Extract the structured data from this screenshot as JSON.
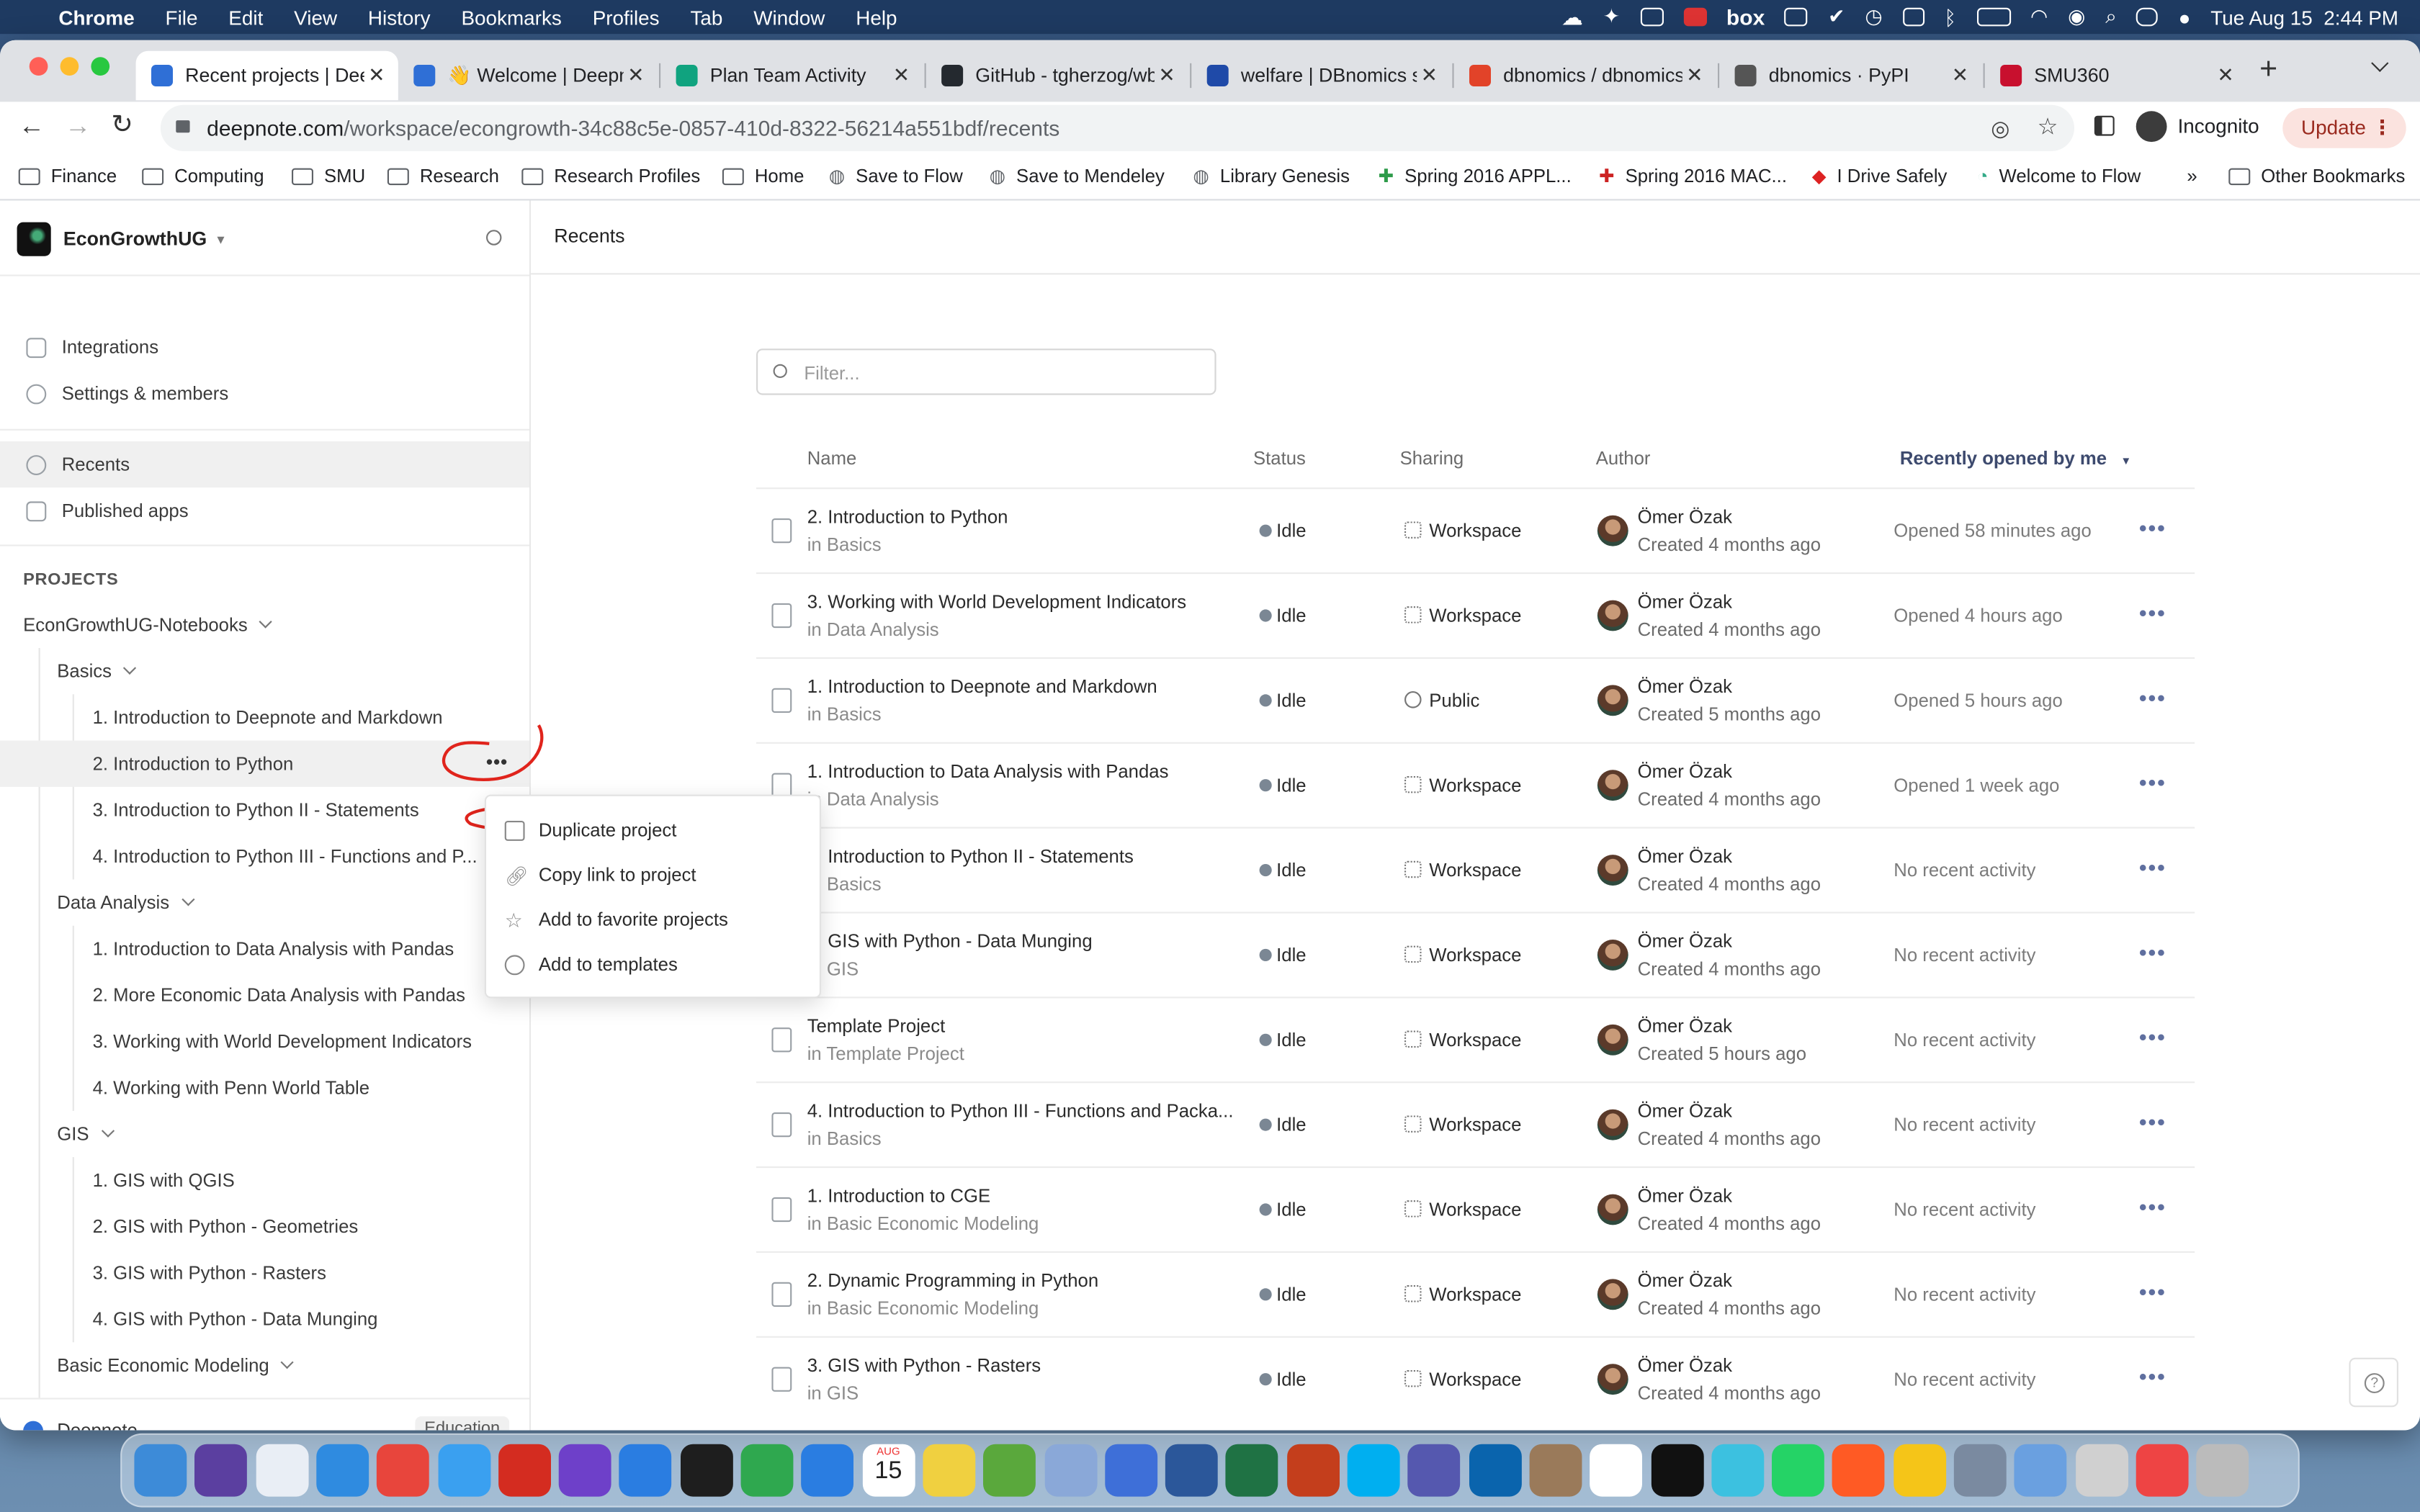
{
  "menubar": {
    "items": [
      "Chrome",
      "File",
      "Edit",
      "View",
      "History",
      "Bookmarks",
      "Profiles",
      "Tab",
      "Window",
      "Help"
    ],
    "tray_text": "box",
    "clock": "Tue Aug 15  2:44 PM"
  },
  "tabs": [
    {
      "title": "Recent projects | Deepnote",
      "color": "#2f6fd6"
    },
    {
      "title": "👋 Welcome | Deepnote",
      "color": "#2f6fd6"
    },
    {
      "title": "Plan Team Activity",
      "color": "#10a37f"
    },
    {
      "title": "GitHub - tgherzog/wbgapi",
      "color": "#24292f"
    },
    {
      "title": "welfare | DBnomics search",
      "color": "#1f4aa8"
    },
    {
      "title": "dbnomics / dbnomics",
      "color": "#e24329"
    },
    {
      "title": "dbnomics · PyPI",
      "color": "#555555"
    },
    {
      "title": "SMU360",
      "color": "#c8102e"
    }
  ],
  "address": {
    "domain": "deepnote.com",
    "path": "/workspace/econgrowth-34c88c5e-0857-410d-8322-56214a551bdf/recents",
    "profile": "Incognito",
    "update": "Update"
  },
  "bookmarks": [
    "Finance",
    "Computing",
    "SMU",
    "Research",
    "Research Profiles",
    "Home",
    "Save to Flow",
    "Save to Mendeley",
    "Library Genesis",
    "Spring 2016 APPL...",
    "Spring 2016 MAC...",
    "I Drive Safely",
    "Welcome to Flow"
  ],
  "bookmarks_more": "»",
  "bookmarks_other": "Other Bookmarks",
  "sidebar": {
    "workspace": "EconGrowthUG",
    "integrations": "Integrations",
    "settings": "Settings & members",
    "recents": "Recents",
    "published": "Published apps",
    "projects_heading": "PROJECTS",
    "root": "EconGrowthUG-Notebooks",
    "groups": [
      {
        "label": "Basics",
        "items": [
          "1. Introduction to Deepnote and Markdown",
          "2. Introduction to Python",
          "3. Introduction to Python II - Statements",
          "4. Introduction to Python III - Functions and P..."
        ]
      },
      {
        "label": "Data Analysis",
        "items": [
          "1. Introduction to Data Analysis with Pandas",
          "2. More Economic Data Analysis with Pandas",
          "3. Working with World Development Indicators",
          "4. Working with Penn World Table"
        ]
      },
      {
        "label": "GIS",
        "items": [
          "1. GIS with QGIS",
          "2. GIS with Python - Geometries",
          "3. GIS with Python - Rasters",
          "4. GIS with Python - Data Munging"
        ]
      },
      {
        "label": "Basic Economic Modeling",
        "items": []
      }
    ],
    "footer": "Deepnote",
    "footer_badge": "Education"
  },
  "main": {
    "title": "Recents",
    "filter_placeholder": "Filter...",
    "columns": {
      "name": "Name",
      "status": "Status",
      "sharing": "Sharing",
      "author": "Author",
      "sort": "Recently opened by me"
    },
    "rows": [
      {
        "name": "2. Introduction to Python",
        "location": "in Basics",
        "status": "Idle",
        "sharing": "Workspace",
        "author": "Ömer Özak",
        "created": "Created 4 months ago",
        "opened": "Opened 58 minutes ago"
      },
      {
        "name": "3. Working with World Development Indicators",
        "location": "in Data Analysis",
        "status": "Idle",
        "sharing": "Workspace",
        "author": "Ömer Özak",
        "created": "Created 4 months ago",
        "opened": "Opened 4 hours ago"
      },
      {
        "name": "1. Introduction to Deepnote and Markdown",
        "location": "in Basics",
        "status": "Idle",
        "sharing": "Public",
        "author": "Ömer Özak",
        "created": "Created 5 months ago",
        "opened": "Opened 5 hours ago"
      },
      {
        "name": "1. Introduction to Data Analysis with Pandas",
        "location": "in Data Analysis",
        "status": "Idle",
        "sharing": "Workspace",
        "author": "Ömer Özak",
        "created": "Created 4 months ago",
        "opened": "Opened 1 week ago"
      },
      {
        "name": "3. Introduction to Python II - Statements",
        "location": "in Basics",
        "status": "Idle",
        "sharing": "Workspace",
        "author": "Ömer Özak",
        "created": "Created 4 months ago",
        "opened": "No recent activity"
      },
      {
        "name": "4. GIS with Python - Data Munging",
        "location": "in GIS",
        "status": "Idle",
        "sharing": "Workspace",
        "author": "Ömer Özak",
        "created": "Created 4 months ago",
        "opened": "No recent activity"
      },
      {
        "name": "Template Project",
        "location": "in Template Project",
        "status": "Idle",
        "sharing": "Workspace",
        "author": "Ömer Özak",
        "created": "Created 5 hours ago",
        "opened": "No recent activity"
      },
      {
        "name": "4. Introduction to Python III - Functions and Packa...",
        "location": "in Basics",
        "status": "Idle",
        "sharing": "Workspace",
        "author": "Ömer Özak",
        "created": "Created 4 months ago",
        "opened": "No recent activity"
      },
      {
        "name": "1. Introduction to CGE",
        "location": "in Basic Economic Modeling",
        "status": "Idle",
        "sharing": "Workspace",
        "author": "Ömer Özak",
        "created": "Created 4 months ago",
        "opened": "No recent activity"
      },
      {
        "name": "2. Dynamic Programming in Python",
        "location": "in Basic Economic Modeling",
        "status": "Idle",
        "sharing": "Workspace",
        "author": "Ömer Özak",
        "created": "Created 4 months ago",
        "opened": "No recent activity"
      },
      {
        "name": "3. GIS with Python - Rasters",
        "location": "in GIS",
        "status": "Idle",
        "sharing": "Workspace",
        "author": "Ömer Özak",
        "created": "Created 4 months ago",
        "opened": "No recent activity"
      }
    ]
  },
  "context_menu": {
    "items": [
      "Duplicate project",
      "Copy link to project",
      "Add to favorite projects",
      "Add to templates"
    ]
  },
  "dock": {
    "calendar_month": "AUG",
    "calendar_day": "15",
    "icon_colors": [
      "#3d8bd8",
      "#5b3fa0",
      "#e9eef5",
      "#2f8be0",
      "#e8453c",
      "#3aa0f0",
      "#d42c20",
      "#6e40c9",
      "#2a7de1",
      "#1e1e1e",
      "#2fa84f",
      "#2a7de1",
      "#8e8e8e",
      "#f0d040",
      "#5aa83c",
      "#8aa8d8",
      "#3e6fd8",
      "#2b579a",
      "#1f7244",
      "#c43e1c",
      "#00aff0",
      "#5558af",
      "#0a64ad",
      "#9a7a5a",
      "#ffffff",
      "#111111",
      "#3cc1e0",
      "#25d366",
      "#ff5a24",
      "#f5c518",
      "#7a8aa0",
      "#6aa0e0",
      "#d0d0d0",
      "#e44",
      "#bbbbbb"
    ]
  }
}
